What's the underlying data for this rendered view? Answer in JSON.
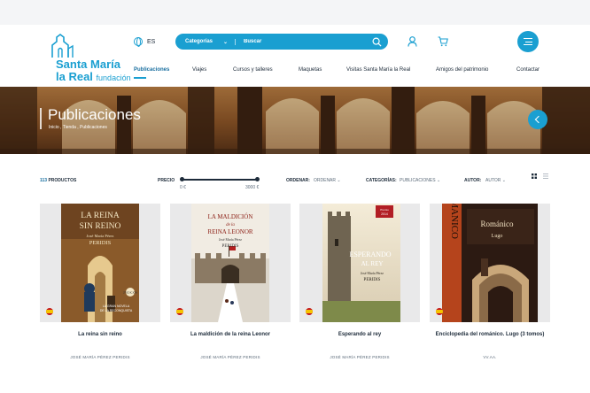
{
  "brand": {
    "line1": "Santa María",
    "line2": "la Real",
    "line2_suffix": "fundación",
    "color": "#1a9fd1"
  },
  "header": {
    "language": "ES",
    "search_category": "Categorías",
    "search_placeholder": "Buscar"
  },
  "nav": {
    "items": [
      {
        "label": "Publicaciones",
        "active": true
      },
      {
        "label": "Viajes"
      },
      {
        "label": "Cursos y talleres"
      },
      {
        "label": "Maquetas"
      },
      {
        "label": "Visitas Santa María la Real"
      },
      {
        "label": "Amigos del patrimonio"
      },
      {
        "label": "Contactar"
      }
    ]
  },
  "hero": {
    "title": "Publicaciones",
    "breadcrumb": "Inicio  ,  Tienda  ,  Publicaciones"
  },
  "filters": {
    "products_count": "113",
    "products_label": "PRODUCTOS",
    "price_label": "PRECIO",
    "price_min": "0 €",
    "price_max": "3000 €",
    "order_label": "ORDENAR:",
    "order_value": "ORDENAR",
    "category_label": "CATEGORÍAS:",
    "category_value": "PUBLICACIONES",
    "author_label": "AUTOR:",
    "author_value": "AUTOR"
  },
  "products": [
    {
      "title": "La reina sin reino",
      "author": "JOSÉ MARÍA PÉREZ PERIDIS",
      "cover_title_1": "LA REINA",
      "cover_title_2": "SIN REINO",
      "cover_author_1": "José María Pérez",
      "cover_author_2": "PERIDIS",
      "cover_tagline_1": "LA GRAN NOVELA",
      "cover_tagline_2": "DE LA RECONQUISTA",
      "cover_badge": "2ª EDICIÓN"
    },
    {
      "title": "La maldición de la reina Leonor",
      "author": "JOSÉ MARÍA PÉREZ PERIDIS",
      "cover_title_1": "LA MALDICIÓN",
      "cover_title_2": "de la",
      "cover_title_3": "REINA LEONOR",
      "cover_author_1": "José María Pérez",
      "cover_author_2": "PERIDIS"
    },
    {
      "title": "Esperando al rey",
      "author": "JOSÉ MARÍA PÉREZ PERIDIS",
      "cover_title_1": "ESPERANDO",
      "cover_title_2": "AL REY",
      "cover_author_1": "José María Pérez",
      "cover_author_2": "PERIDIS",
      "cover_award_1": "Premio",
      "cover_award_2": "2014"
    },
    {
      "title": "Enciclopedia del románico. Lugo (3 tomos)",
      "author": "VV.AA.",
      "cover_word_1": "ROMANICO",
      "cover_word_2": "Románico",
      "cover_word_3": "Lugo"
    }
  ]
}
